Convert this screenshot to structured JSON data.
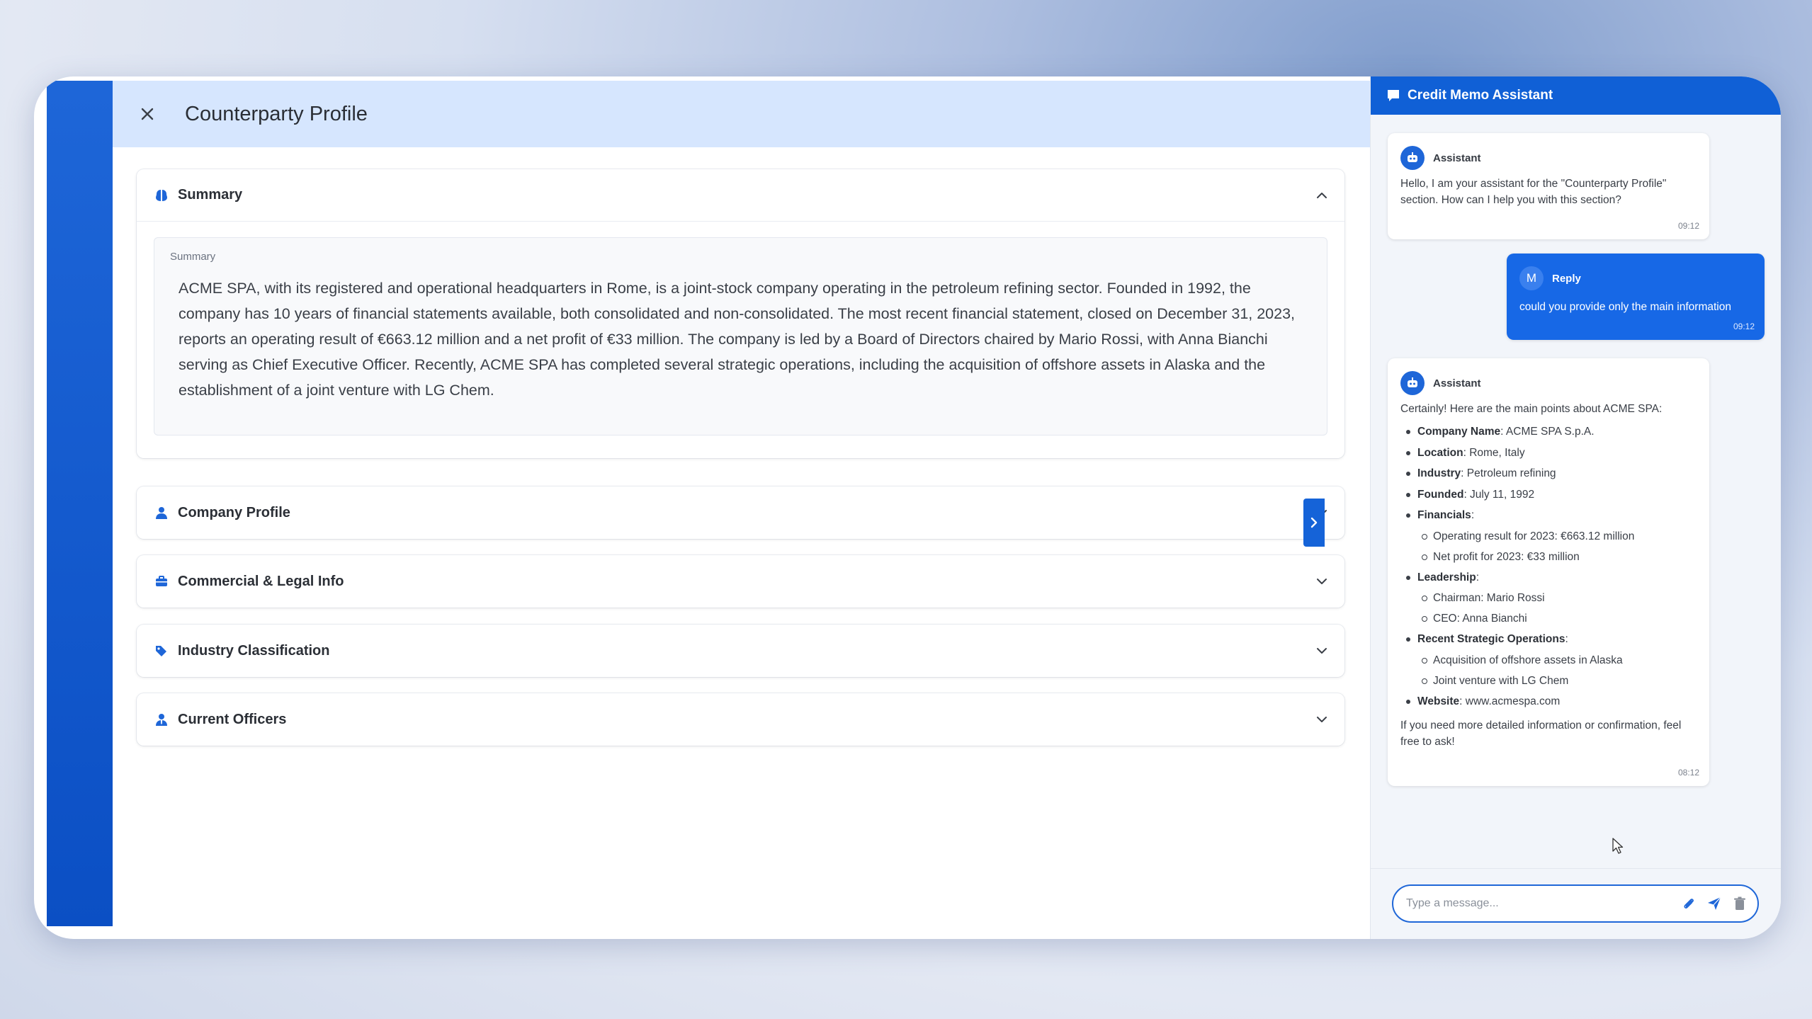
{
  "main": {
    "title": "Counterparty Profile",
    "sections": {
      "summary": {
        "label": "Summary",
        "field_label": "Summary",
        "text": "ACME SPA, with its registered and operational headquarters in Rome, is a joint-stock company operating in the petroleum refining sector. Founded in 1992, the company has 10 years of financial statements available, both consolidated and non-consolidated. The most recent financial statement, closed on December 31, 2023, reports an operating result of €663.12 million and a net profit of €33 million. The company is led by a Board of Directors chaired by Mario Rossi, with Anna Bianchi serving as Chief Executive Officer. Recently, ACME SPA has completed several strategic operations, including the acquisition of offshore assets in Alaska and the establishment of a joint venture with LG Chem."
      },
      "company_profile": {
        "label": "Company Profile"
      },
      "commercial_legal": {
        "label": "Commercial & Legal Info"
      },
      "industry": {
        "label": "Industry Classification"
      },
      "officers": {
        "label": "Current Officers"
      }
    }
  },
  "chat": {
    "title": "Credit Memo Assistant",
    "messages": [
      {
        "author": "Assistant",
        "text": "Hello, I am your assistant for the \"Counterparty Profile\" section. How can I help you with this section?",
        "time": "09:12"
      },
      {
        "avatar_initial": "M",
        "author": "Reply",
        "text": "could you provide only the main information",
        "time": "09:12"
      },
      {
        "author": "Assistant",
        "intro": "Certainly! Here are the main points about ACME SPA:",
        "points": {
          "company_name": {
            "key": "Company Name",
            "value": ": ACME SPA S.p.A."
          },
          "location": {
            "key": "Location",
            "value": ": Rome, Italy"
          },
          "industry": {
            "key": "Industry",
            "value": ": Petroleum refining"
          },
          "founded": {
            "key": "Founded",
            "value": ": July 11, 1992"
          },
          "financials": {
            "key": "Financials",
            "value": ":"
          },
          "fin_1": "Operating result for 2023: €663.12 million",
          "fin_2": "Net profit for 2023: €33 million",
          "leadership": {
            "key": "Leadership",
            "value": ":"
          },
          "lead_1": "Chairman: Mario Rossi",
          "lead_2": "CEO: Anna Bianchi",
          "recent_ops": {
            "key": "Recent Strategic Operations",
            "value": ":"
          },
          "ops_1": "Acquisition of offshore assets in Alaska",
          "ops_2": "Joint venture with LG Chem",
          "website": {
            "key": "Website",
            "value": ": www.acmespa.com"
          }
        },
        "outro": "If you need more detailed information or confirmation, feel free to ask!",
        "time": "08:12"
      }
    ],
    "composer": {
      "placeholder": "Type a message..."
    },
    "icons": [
      "chat-icon",
      "robot-icon",
      "paperclip-icon",
      "send-icon",
      "trash-icon"
    ]
  },
  "colors": {
    "primary": "#1060d6",
    "header_bg": "#d6e6fe",
    "chat_bg": "#f2f5fa"
  }
}
